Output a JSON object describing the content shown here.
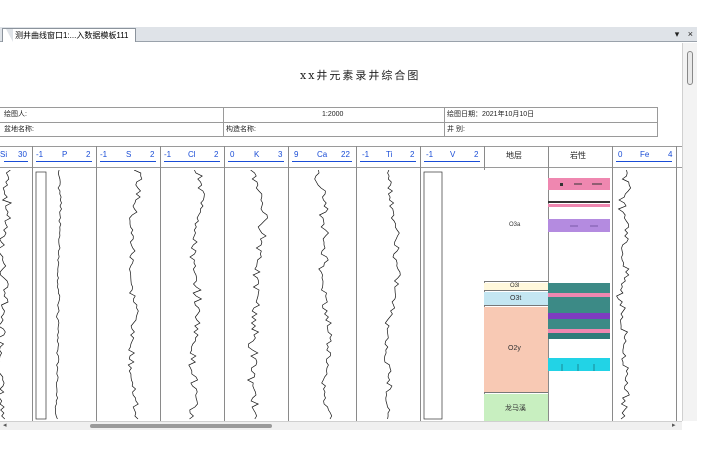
{
  "tab": {
    "label": "测井曲线窗口1:...入数据模板111"
  },
  "window_controls": {
    "dropdown": "▾",
    "close": "×"
  },
  "chart_title": "xx井元素录井综合图",
  "info": {
    "drawer": "绘图人:",
    "scale": "1:2000",
    "date": "绘图日期：2021年10月10日",
    "basin": "盆地名称:",
    "structure": "构造名称:",
    "well_type": "井   别:"
  },
  "tracks": [
    {
      "name": "Si",
      "min": "",
      "max": "30",
      "show_min": false
    },
    {
      "name": "P",
      "min": "-1",
      "max": "2"
    },
    {
      "name": "S",
      "min": "-1",
      "max": "2"
    },
    {
      "name": "Cl",
      "min": "-1",
      "max": "2"
    },
    {
      "name": "K",
      "min": "0",
      "max": "3"
    },
    {
      "name": "Ca",
      "min": "9",
      "max": "22"
    },
    {
      "name": "Ti",
      "min": "-1",
      "max": "2"
    },
    {
      "name": "V",
      "min": "-1",
      "max": "2"
    }
  ],
  "formation_header": "地层",
  "lithology_header": "岩性",
  "fe_track": {
    "name": "Fe",
    "min": "0",
    "max": "4"
  },
  "formations": [
    {
      "label": "O3a",
      "color": "#ffffff"
    },
    {
      "label": "O3l",
      "color": "#fff8dc"
    },
    {
      "label": "O3t",
      "color": "#c4e6f2"
    },
    {
      "label": "O2y",
      "color": "#f8c9b4"
    },
    {
      "label": "龙马溪",
      "color": "#c8efc0"
    }
  ],
  "colors": {
    "accent": "#1a4dd6",
    "grid": "#8a8a8a",
    "pink": "#ef87b0",
    "purple": "#b48be0",
    "teal": "#3c8a86",
    "cyan": "#22d3e6"
  }
}
